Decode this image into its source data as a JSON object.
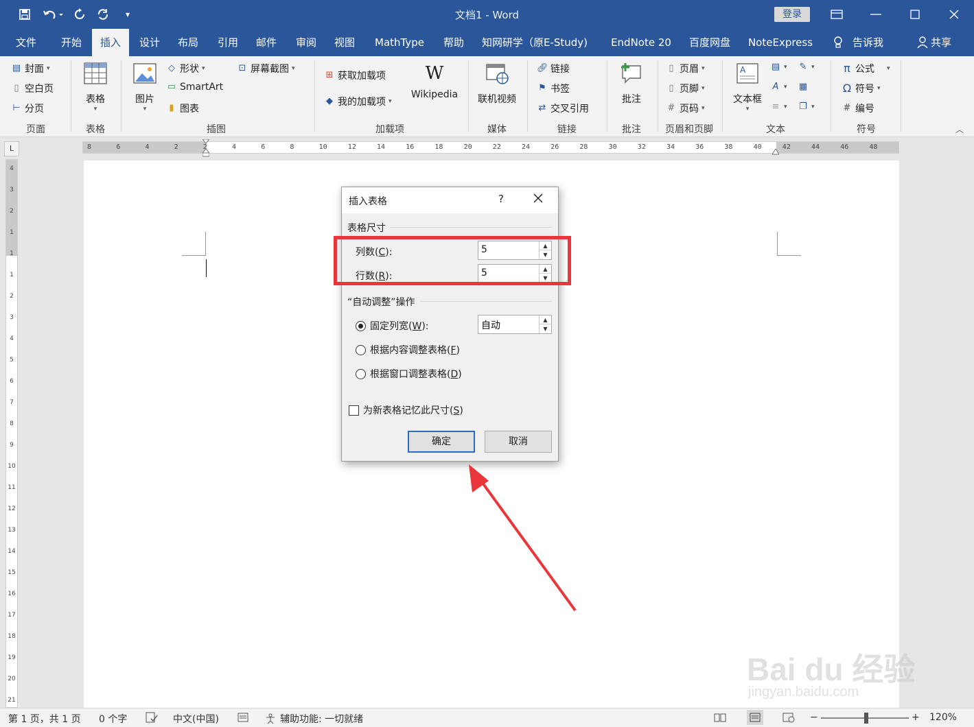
{
  "window": {
    "title": "文档1  -  Word",
    "login_label": "登录"
  },
  "tabs": [
    {
      "label": "文件"
    },
    {
      "label": "开始"
    },
    {
      "label": "插入",
      "active": true
    },
    {
      "label": "设计"
    },
    {
      "label": "布局"
    },
    {
      "label": "引用"
    },
    {
      "label": "邮件"
    },
    {
      "label": "审阅"
    },
    {
      "label": "视图"
    },
    {
      "label": "MathType"
    },
    {
      "label": "帮助"
    },
    {
      "label": "知网研学（原E-Study)"
    },
    {
      "label": "EndNote 20"
    },
    {
      "label": "百度网盘"
    },
    {
      "label": "NoteExpress"
    },
    {
      "label": "告诉我"
    },
    {
      "label": "共享"
    }
  ],
  "ribbon": {
    "pages": {
      "cover": "封面",
      "blank": "空白页",
      "break": "分页",
      "group": "页面"
    },
    "tables": {
      "table": "表格",
      "group": "表格"
    },
    "illustrations": {
      "picture": "图片",
      "shapes": "形状",
      "smartart": "SmartArt",
      "chart": "图表",
      "screenshot": "屏幕截图",
      "group": "插图"
    },
    "addins": {
      "get": "获取加载项",
      "mine": "我的加载项",
      "wikipedia": "Wikipedia",
      "group": "加载项"
    },
    "media": {
      "video": "联机视频",
      "group": "媒体"
    },
    "links": {
      "link": "链接",
      "bookmark": "书签",
      "crossref": "交叉引用",
      "group": "链接"
    },
    "comments": {
      "comment": "批注",
      "group": "批注"
    },
    "header_footer": {
      "header": "页眉",
      "footer": "页脚",
      "page_number": "页码",
      "group": "页眉和页脚"
    },
    "text": {
      "textbox": "文本框",
      "group": "文本"
    },
    "symbols": {
      "equation": "公式",
      "symbol": "符号",
      "number": "编号",
      "group": "符号"
    }
  },
  "ruler": {
    "h_ticks": [
      "8",
      "6",
      "4",
      "2",
      "2",
      "4",
      "6",
      "8",
      "10",
      "12",
      "14",
      "16",
      "18",
      "20",
      "22",
      "24",
      "26",
      "28",
      "30",
      "32",
      "34",
      "36",
      "38",
      "40",
      "42",
      "44",
      "46",
      "48"
    ],
    "v_ticks": [
      "4",
      "3",
      "2",
      "1",
      "1",
      "1",
      "2",
      "3",
      "4",
      "5",
      "6",
      "7",
      "8",
      "9",
      "10",
      "11",
      "12",
      "13",
      "14",
      "15",
      "16",
      "17",
      "18",
      "19",
      "20",
      "21"
    ]
  },
  "dialog": {
    "title": "插入表格",
    "help": "?",
    "size_section": "表格尺寸",
    "columns_label": "列数(",
    "columns_key": "C",
    "columns_tail": "):",
    "columns_value": "5",
    "rows_label": "行数(",
    "rows_key": "R",
    "rows_tail": "):",
    "rows_value": "5",
    "autofit_section": "“自动调整”操作",
    "fixed_label": "固定列宽(",
    "fixed_key": "W",
    "fixed_tail": "):",
    "fixed_value": "自动",
    "content_label": "根据内容调整表格(",
    "content_key": "F",
    "content_tail": ")",
    "window_label": "根据窗口调整表格(",
    "window_key": "D",
    "window_tail": ")",
    "remember_label": "为新表格记忆此尺寸(",
    "remember_key": "S",
    "remember_tail": ")",
    "ok": "确定",
    "cancel": "取消"
  },
  "status": {
    "page": "第 1 页，共 1 页",
    "words": "0 个字",
    "language": "中文(中国)",
    "accessibility": "辅助功能: 一切就绪",
    "zoom": "120%"
  },
  "watermark": {
    "line1": "Bai du 经验",
    "line2": "jingyan.baidu.com"
  },
  "colors": {
    "brand": "#2b579a",
    "highlight": "#e8363a"
  }
}
